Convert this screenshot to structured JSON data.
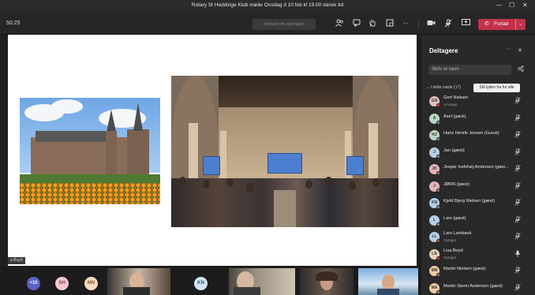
{
  "window": {
    "title": "Rotary St Heddinge Klub møde Onsdag d 10 feb kl 19.00 dansk tid",
    "minimize": "—",
    "maximize": "☐",
    "close": "✕"
  },
  "toolbar": {
    "timer": "50:25",
    "chat_placeholder": "Anmod om styringen",
    "leave_label": "Forlad",
    "leave_icon": "✆",
    "leave_chevron": "⌄",
    "more": "···",
    "icons": [
      "people-icon",
      "chat-icon",
      "raise-hand-icon",
      "rooms-icon",
      "more-icon",
      "camera-icon",
      "mic-muted-icon",
      "share-screen-icon"
    ]
  },
  "stage": {
    "shared_by": "a Boyd"
  },
  "panel": {
    "title": "Deltagere",
    "more": "···",
    "close": "✕",
    "search_placeholder": "Skriv et navn",
    "section": "I dette møde (17)",
    "tooltip": "Slå lyden fra for alle",
    "participants": [
      {
        "initials": "GN",
        "name": "Gert Nielsen",
        "role": "Arrangør",
        "avatar_color": "#e3bfc4",
        "presence_color": "#cc4a31",
        "mic": "muted"
      },
      {
        "initials": "A",
        "name": "Axel (gæst)",
        "role": "",
        "avatar_color": "#b6d7c0",
        "presence_color": "#888888",
        "mic": "muted"
      },
      {
        "initials": "HJ",
        "name": "Hans Henrik Jensen (Guest)",
        "role": "",
        "avatar_color": "#b9d6c1",
        "presence_color": "#888888",
        "mic": "muted"
      },
      {
        "initials": "J",
        "name": "Jan (gæst)",
        "role": "",
        "avatar_color": "#b7cfe6",
        "presence_color": "#888888",
        "mic": "muted"
      },
      {
        "initials": "JK",
        "name": "Jesper Isefshøj-Andersen (gæe...",
        "role": "",
        "avatar_color": "#e2b4bb",
        "presence_color": "#888888",
        "mic": "muted"
      },
      {
        "initials": "J",
        "name": "JØRN (gæst)",
        "role": "",
        "avatar_color": "#e4b5bd",
        "presence_color": "#888888",
        "mic": "muted"
      },
      {
        "initials": "KN",
        "name": "Kjeld Bjerg Nielsen (gæst)",
        "role": "",
        "avatar_color": "#b7cfe6",
        "presence_color": "#888888",
        "mic": "muted"
      },
      {
        "initials": "L",
        "name": "Lars (gæst)",
        "role": "",
        "avatar_color": "#b7cfe6",
        "presence_color": "#888888",
        "mic": "muted"
      },
      {
        "initials": "LL",
        "name": "Lars Lambaek",
        "role": "Optaget",
        "avatar_color": "#b7cfe6",
        "presence_color": "#cc4a31",
        "mic": "muted"
      },
      {
        "initials": "LB",
        "name": "Lisa Boyd",
        "role": "Optaget",
        "avatar_color": "#e9d4b8",
        "presence_color": "#cc4a31",
        "mic": "active"
      },
      {
        "initials": "MN",
        "name": "Martin Nielsen (gæst)",
        "role": "",
        "avatar_color": "#f0cba5",
        "presence_color": "#888888",
        "mic": "muted"
      },
      {
        "initials": "MA",
        "name": "Martin Storm Andersen (gæst)",
        "role": "",
        "avatar_color": "#f0cba5",
        "presence_color": "#888888",
        "mic": "muted"
      }
    ]
  },
  "strip": {
    "overflow": "+10",
    "avatars": [
      {
        "initials": "SH",
        "color": "#f3c7cf",
        "text": "#8a3a4d"
      },
      {
        "initials": "MN",
        "color": "#f3dcc0",
        "text": "#8a5a2a"
      },
      {
        "initials": "KN",
        "color": "#d0e6f3",
        "text": "#2a5a7a"
      }
    ]
  },
  "icons": {
    "mic_muted": "🎙̸",
    "mic": "🎙",
    "share": "⎘"
  }
}
